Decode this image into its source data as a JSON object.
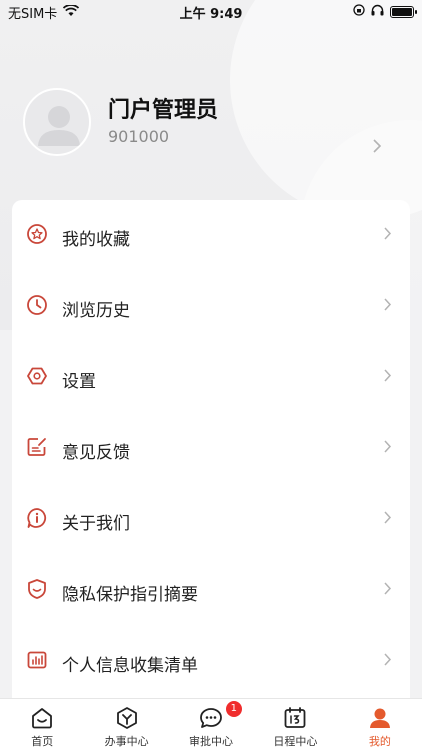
{
  "status_bar": {
    "carrier": "无SIM卡",
    "time": "上午 9:49"
  },
  "profile": {
    "name": "门户管理员",
    "id": "901000"
  },
  "menu": {
    "items": [
      {
        "label": "我的收藏",
        "icon": "star-icon"
      },
      {
        "label": "浏览历史",
        "icon": "clock-icon"
      },
      {
        "label": "设置",
        "icon": "hexagon-settings-icon"
      },
      {
        "label": "意见反馈",
        "icon": "feedback-edit-icon"
      },
      {
        "label": "关于我们",
        "icon": "info-bubble-icon"
      },
      {
        "label": "隐私保护指引摘要",
        "icon": "shield-icon"
      },
      {
        "label": "个人信息收集清单",
        "icon": "bar-chart-icon"
      }
    ]
  },
  "tabbar": {
    "tabs": [
      {
        "label": "首页",
        "icon": "home-icon"
      },
      {
        "label": "办事中心",
        "icon": "cube-icon"
      },
      {
        "label": "审批中心",
        "icon": "chat-bubble-icon",
        "badge": "1"
      },
      {
        "label": "日程中心",
        "icon": "calendar-icon"
      },
      {
        "label": "我的",
        "icon": "person-icon"
      }
    ]
  },
  "colors": {
    "accent": "#e45a2d",
    "icon_red": "#c9473a",
    "badge": "#f02d2d"
  }
}
